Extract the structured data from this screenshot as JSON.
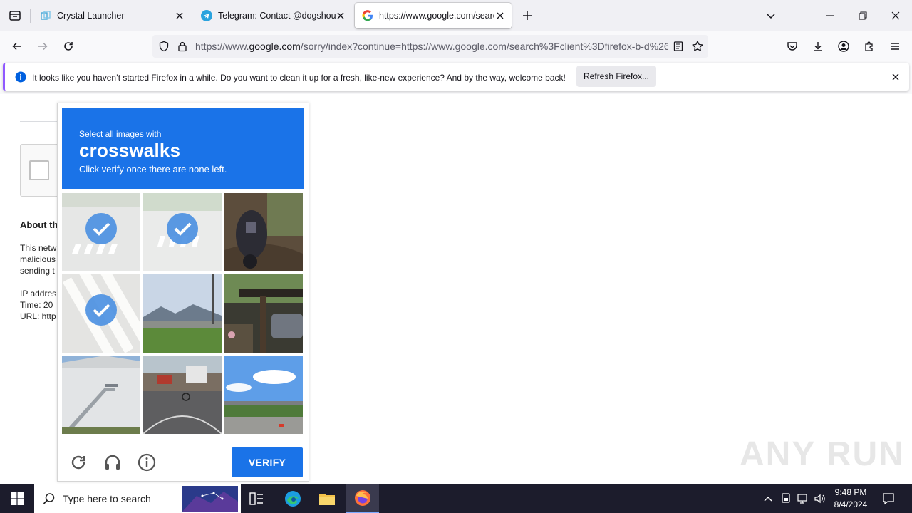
{
  "tabs": [
    {
      "title": "Crystal Launcher",
      "active": false
    },
    {
      "title": "Telegram: Contact @dogshouse",
      "active": false
    },
    {
      "title": "https://www.google.com/search",
      "active": true
    }
  ],
  "urlbar": {
    "prefix": "https://www.",
    "domain": "google.com",
    "rest": "/sorry/index?continue=https://www.google.com/search%3Fclient%3Dfirefox-b-d%26"
  },
  "notification": {
    "message": "It looks like you haven’t started Firefox in a while. Do you want to clean it up for a fresh, like-new experience? And by the way, welcome back!",
    "button": "Refresh Firefox..."
  },
  "background_page": {
    "heading": "About th",
    "para1": "This netw",
    "para2": "malicious",
    "para3": "sending t",
    "ip": "IP addres",
    "time": "Time: 20",
    "url": "URL: http"
  },
  "captcha": {
    "line1": "Select all images with",
    "keyword": "crosswalks",
    "line3": "Click verify once there are none left.",
    "verify": "VERIFY",
    "tiles": [
      {
        "selected": true
      },
      {
        "selected": true
      },
      {
        "selected": false
      },
      {
        "selected": true
      },
      {
        "selected": false
      },
      {
        "selected": false
      },
      {
        "selected": false
      },
      {
        "selected": false
      },
      {
        "selected": false
      }
    ]
  },
  "taskbar": {
    "search_placeholder": "Type here to search",
    "time": "9:48 PM",
    "date": "8/4/2024"
  },
  "watermark": "ANY RUN",
  "colors": {
    "accent": "#1a73e8",
    "taskbar": "#1c1c2c"
  }
}
